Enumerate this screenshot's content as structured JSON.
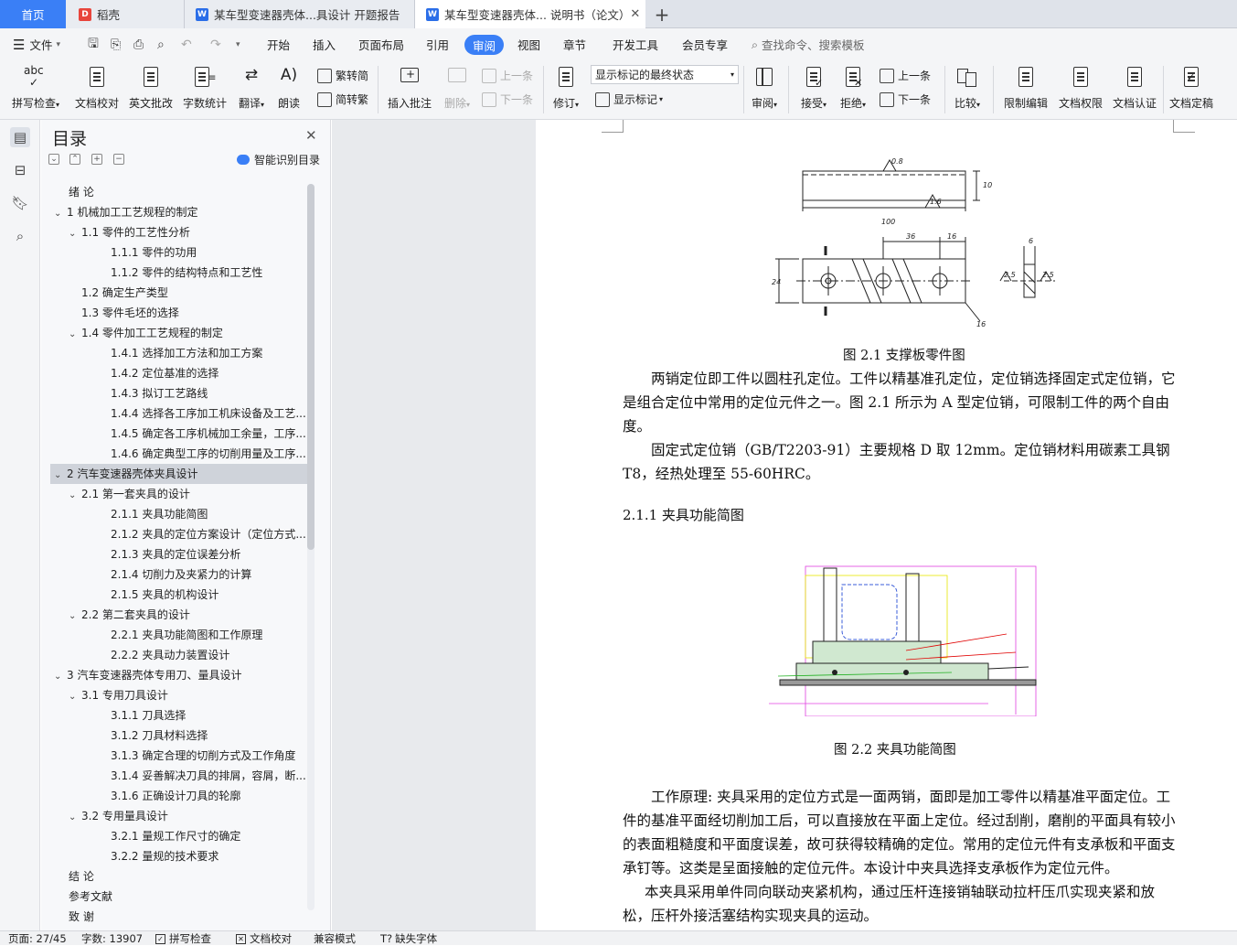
{
  "tabs": {
    "home": "首页",
    "daoke": "稻壳",
    "doc1": "某车型变速器壳体...具设计 开题报告",
    "doc2": "某车型变速器壳体... 说明书（论文）",
    "add": "+"
  },
  "menu": {
    "file": "文件",
    "items": [
      "开始",
      "插入",
      "页面布局",
      "引用",
      "审阅",
      "视图",
      "章节",
      "开发工具",
      "会员专享"
    ],
    "search": "查找命令、搜索模板"
  },
  "ribbon": {
    "spell": "拼写检查",
    "proof": "文档校对",
    "eng": "英文批改",
    "count": "字数统计",
    "translate": "翻译",
    "read": "朗读",
    "trad": "繁转简",
    "simp": "简转繁",
    "insert_comment": "插入批注",
    "delete": "删除",
    "prev": "上一条",
    "next": "下一条",
    "track": "修订",
    "markup_state": "显示标记的最终状态",
    "show_markup": "显示标记",
    "review_pane": "审阅",
    "accept": "接受",
    "reject": "拒绝",
    "prev2": "上一条",
    "next2": "下一条",
    "compare": "比较",
    "restrict": "限制编辑",
    "rights": "文档权限",
    "cert": "文档认证",
    "finalize": "文档定稿"
  },
  "toc": {
    "title": "目录",
    "smart": "智能识别目录",
    "items": [
      {
        "text": "绪  论",
        "level": 1,
        "arrow": ""
      },
      {
        "text": "1  机械加工工艺规程的制定",
        "level": 1,
        "arrow": "⌄"
      },
      {
        "text": "1.1  零件的工艺性分析",
        "level": 2,
        "arrow": "⌄"
      },
      {
        "text": "1.1.1  零件的功用",
        "level": 3,
        "arrow": ""
      },
      {
        "text": "1.1.2  零件的结构特点和工艺性",
        "level": 3,
        "arrow": ""
      },
      {
        "text": "1.2  确定生产类型",
        "level": 2,
        "arrow": ""
      },
      {
        "text": "1.3  零件毛坯的选择",
        "level": 2,
        "arrow": ""
      },
      {
        "text": "1.4  零件加工工艺规程的制定",
        "level": 2,
        "arrow": "⌄"
      },
      {
        "text": "1.4.1  选择加工方法和加工方案",
        "level": 3,
        "arrow": ""
      },
      {
        "text": "1.4.2  定位基准的选择",
        "level": 3,
        "arrow": ""
      },
      {
        "text": "1.4.3  拟订工艺路线",
        "level": 3,
        "arrow": ""
      },
      {
        "text": "1.4.4  选择各工序加工机床设备及工艺...",
        "level": 3,
        "arrow": ""
      },
      {
        "text": "1.4.5  确定各工序机械加工余量，工序...",
        "level": 3,
        "arrow": ""
      },
      {
        "text": "1.4.6  确定典型工序的切削用量及工序...",
        "level": 3,
        "arrow": ""
      },
      {
        "text": "2  汽车变速器壳体夹具设计",
        "level": 1,
        "arrow": "⌄",
        "selected": true
      },
      {
        "text": "2.1  第一套夹具的设计",
        "level": 2,
        "arrow": "⌄"
      },
      {
        "text": "2.1.1  夹具功能简图",
        "level": 3,
        "arrow": ""
      },
      {
        "text": "2.1.2  夹具的定位方案设计（定位方式...",
        "level": 3,
        "arrow": ""
      },
      {
        "text": "2.1.3  夹具的定位误差分析",
        "level": 3,
        "arrow": ""
      },
      {
        "text": "2.1.4  切削力及夹紧力的计算",
        "level": 3,
        "arrow": ""
      },
      {
        "text": "2.1.5  夹具的机构设计",
        "level": 3,
        "arrow": ""
      },
      {
        "text": "2.2  第二套夹具的设计",
        "level": 2,
        "arrow": "⌄"
      },
      {
        "text": "2.2.1  夹具功能简图和工作原理",
        "level": 3,
        "arrow": ""
      },
      {
        "text": "2.2.2  夹具动力装置设计",
        "level": 3,
        "arrow": ""
      },
      {
        "text": "3  汽车变速器壳体专用刀、量具设计",
        "level": 1,
        "arrow": "⌄"
      },
      {
        "text": "3.1  专用刀具设计",
        "level": 2,
        "arrow": "⌄"
      },
      {
        "text": "3.1.1  刀具选择",
        "level": 3,
        "arrow": ""
      },
      {
        "text": "3.1.2  刀具材料选择",
        "level": 3,
        "arrow": ""
      },
      {
        "text": "3.1.3  确定合理的切削方式及工作角度",
        "level": 3,
        "arrow": ""
      },
      {
        "text": "3.1.4  妥善解决刀具的排屑，容屑，断...",
        "level": 3,
        "arrow": ""
      },
      {
        "text": "3.1.6  正确设计刀具的轮廓",
        "level": 3,
        "arrow": ""
      },
      {
        "text": "3.2  专用量具设计",
        "level": 2,
        "arrow": "⌄"
      },
      {
        "text": "3.2.1  量规工作尺寸的确定",
        "level": 3,
        "arrow": ""
      },
      {
        "text": "3.2.2  量规的技术要求",
        "level": 3,
        "arrow": ""
      },
      {
        "text": "结  论",
        "level": 1,
        "arrow": ""
      },
      {
        "text": "参考文献",
        "level": 1,
        "arrow": ""
      },
      {
        "text": "致  谢",
        "level": 1,
        "arrow": ""
      }
    ]
  },
  "doc": {
    "fig1_caption": "图 2.1 支撑板零件图",
    "fig1_dims": {
      "d100": "100",
      "d10": "10",
      "d36": "36",
      "d16": "16",
      "d24": "24",
      "d16b": "16",
      "d6": "6",
      "r08": "0.8",
      "r16": "1.6",
      "r25a": "2.5",
      "r25b": "2.5"
    },
    "para1": "两销定位即工件以圆柱孔定位。工件以精基准孔定位，定位销选择固定式定位销，它是组合定位中常用的定位元件之一。图 2.1 所示为 A 型定位销，可限制工件的两个自由度。",
    "para2": "固定式定位销（GB/T2203-91）主要规格 D 取 12mm。定位销材料用碳素工具钢 T8，经热处理至 55-60HRC。",
    "heading": "2.1.1  夹具功能简图",
    "fig2_caption": "图 2.2 夹具功能简图",
    "para3": "工作原理: 夹具采用的定位方式是一面两销，面即是加工零件以精基准平面定位。工件的基准平面经切削加工后，可以直接放在平面上定位。经过刮削，磨削的平面具有较小的表面粗糙度和平面度误差，故可获得较精确的定位。常用的定位元件有支承板和平面支承钉等。这类是呈面接触的定位元件。本设计中夹具选择支承板作为定位元件。",
    "para4": "本夹具采用单件同向联动夹紧机构，通过压杆连接销轴联动拉杆压爪实现夹紧和放松，压杆外接活塞结构实现夹具的运动。"
  },
  "status": {
    "page": "页面: 27/45",
    "words": "字数: 13907",
    "spell": "拼写检查",
    "proof": "文档校对",
    "compat": "兼容模式",
    "font": "缺失字体"
  }
}
